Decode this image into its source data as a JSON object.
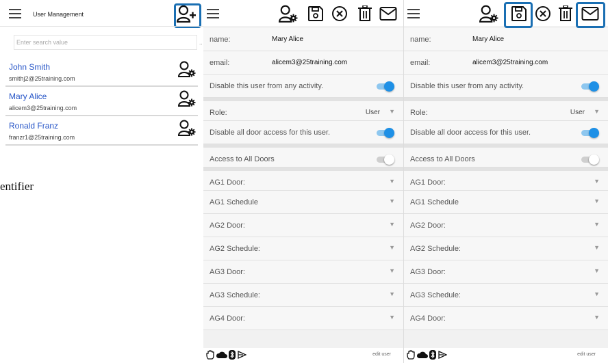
{
  "list_panel": {
    "title": "User Management",
    "search_placeholder": "Enter search value",
    "more_label": "..",
    "users": [
      {
        "name": "John Smith",
        "email": "smithj2@25training.com"
      },
      {
        "name": "Mary Alice",
        "email": "alicem3@25training.com"
      },
      {
        "name": "Ronald Franz",
        "email": "franzr1@25training.com"
      }
    ],
    "stray_text": "entifier"
  },
  "detail_panel": {
    "name_label": "name:",
    "name_value": "Mary Alice",
    "email_label": "email:",
    "email_value": "alicem3@25training.com",
    "disable_user_label": "Disable this user from any activity.",
    "disable_user_on": true,
    "role_label": "Role:",
    "role_value": "User",
    "disable_doors_label": "Disable all door access for this user.",
    "disable_doors_on": true,
    "all_doors_label": "Access to All Doors",
    "all_doors_on": false,
    "fields": [
      "AG1 Door:",
      "AG1 Schedule",
      "AG2 Door:",
      "AG2 Schedule:",
      "AG3 Door:",
      "AG3 Schedule:",
      "AG4 Door:"
    ],
    "footer_label": "edit user"
  },
  "icons": {
    "menu": "hamburger-menu-icon",
    "add_user": "add-user-icon",
    "user_settings": "user-settings-icon",
    "save": "floppy-disk-icon",
    "cancel": "circle-x-icon",
    "delete": "trash-can-icon",
    "email": "envelope-icon",
    "status": [
      "hand-icon",
      "cloud-icon",
      "bluetooth-icon",
      "send-icon"
    ]
  },
  "colors": {
    "accent": "#1e90e6",
    "highlight": "#1a6fb3",
    "link": "#2554c7"
  }
}
